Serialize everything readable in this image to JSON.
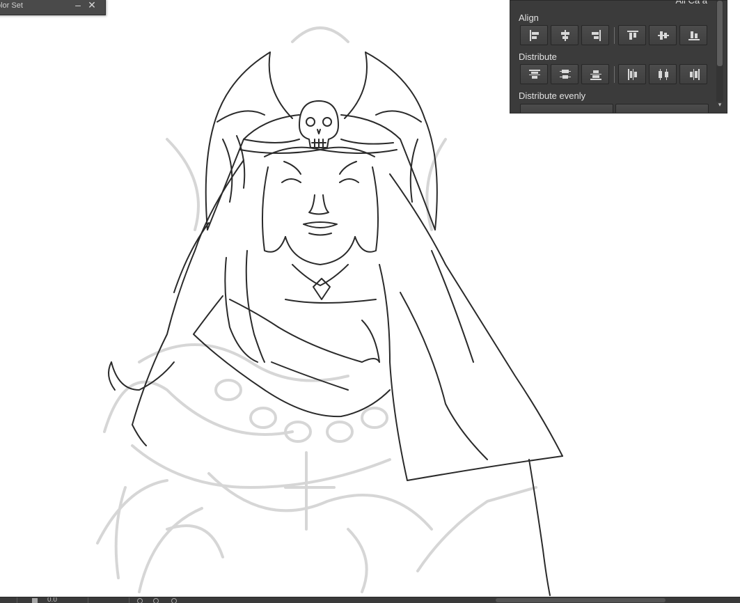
{
  "color_set_window": {
    "title": "olor Set",
    "minimize_glyph": "–",
    "close_glyph": "✕"
  },
  "align_panel": {
    "top_label": "Ali  Ca  a",
    "align_label": "Align",
    "distribute_label": "Distribute",
    "distribute_evenly_label": "Distribute evenly",
    "scroll_down_glyph": "▾",
    "icons": {
      "align": [
        "align-left-icon",
        "align-center-horizontal-icon",
        "align-right-icon",
        "align-top-icon",
        "align-center-vertical-icon",
        "align-bottom-icon"
      ],
      "distribute": [
        "distribute-top-icon",
        "distribute-center-vertical-icon",
        "distribute-bottom-icon",
        "distribute-left-icon",
        "distribute-center-horizontal-icon",
        "distribute-right-icon"
      ]
    }
  },
  "status_bar": {
    "zoom_value": "0.0"
  },
  "colors": {
    "panel_bg": "#3b3b3b",
    "button_bg": "#474747",
    "text": "#e2e2e2",
    "canvas_bg": "#ffffff",
    "line_art": "#2a2a2a",
    "sketch": "#d4d4d4"
  }
}
